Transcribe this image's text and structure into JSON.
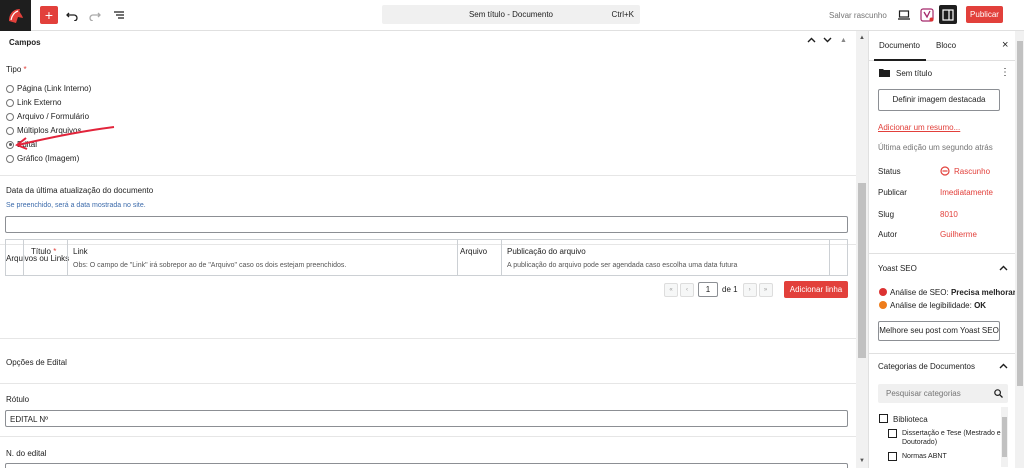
{
  "toolbar": {
    "document_title": "Sem título - Documento",
    "shortcut": "Ctrl+K",
    "save_draft": "Salvar rascunho",
    "publish": "Publicar",
    "add_symbol": "+"
  },
  "campos": {
    "title": "Campos",
    "tipo_label": "Tipo",
    "required_mark": "*",
    "radio_options": [
      {
        "label": "Página (Link Interno)",
        "checked": false
      },
      {
        "label": "Link Externo",
        "checked": false
      },
      {
        "label": "Arquivo / Formulário",
        "checked": false
      },
      {
        "label": "Múltiplos Arquivos",
        "checked": false
      },
      {
        "label": "Edital",
        "checked": true
      },
      {
        "label": "Gráfico (Imagem)",
        "checked": false
      }
    ],
    "data_label": "Data da última atualização do documento",
    "data_hint": "Se preenchido, será a data mostrada no site.",
    "data_value": "",
    "arquivos_label": "Arquivos ou Links",
    "table": {
      "headers": [
        "Título",
        "Link",
        "Arquivo",
        "Publicação do arquivo"
      ],
      "link_note": "Obs: O campo de \"Link\" irá sobrepor ao de \"Arquivo\" caso os dois estejam preenchidos.",
      "pub_note": "A publicação do arquivo pode ser agendada caso escolha uma data futura"
    },
    "pager": {
      "first": "«",
      "prev": "‹",
      "current": "1",
      "of": "de 1",
      "next": "›",
      "last": "»"
    },
    "add_row": "Adicionar linha",
    "opcoes_label": "Opções de Edital",
    "rotulo_label": "Rótulo",
    "rotulo_value": "EDITAL Nº",
    "numero_label": "N. do edital"
  },
  "sidebar": {
    "tab_document": "Documento",
    "tab_block": "Bloco",
    "close": "×",
    "post_title": "Sem título",
    "more": "⋮",
    "featured_image_btn": "Definir imagem destacada",
    "add_excerpt": "Adicionar um resumo...",
    "last_edit": "Última edição um segundo atrás",
    "meta": [
      {
        "key": "Status",
        "value": "Rascunho"
      },
      {
        "key": "Publicar",
        "value": "Imediatamente"
      },
      {
        "key": "Slug",
        "value": "8010"
      },
      {
        "key": "Autor",
        "value": "Guilherme"
      }
    ],
    "yoast": {
      "title": "Yoast SEO",
      "seo_label": "Análise de SEO:",
      "seo_value": "Precisa melhorar",
      "read_label": "Análise de legibilidade:",
      "read_value": "OK",
      "button": "Melhore seu post com Yoast SEO",
      "colors": {
        "bad": "#dc3232",
        "ok": "#ee7c1b"
      }
    },
    "categories": {
      "title": "Categorias de Documentos",
      "search_placeholder": "Pesquisar categorias",
      "items": [
        {
          "label": "Biblioteca",
          "level": 0
        },
        {
          "label": "Dissertação e Tese (Mestrado e Doutorado)",
          "level": 1
        },
        {
          "label": "Normas ABNT",
          "level": 1
        }
      ]
    }
  },
  "colors": {
    "accent": "#e2403b",
    "dark": "#1e1e1e",
    "hint_blue": "#3c6bab"
  }
}
